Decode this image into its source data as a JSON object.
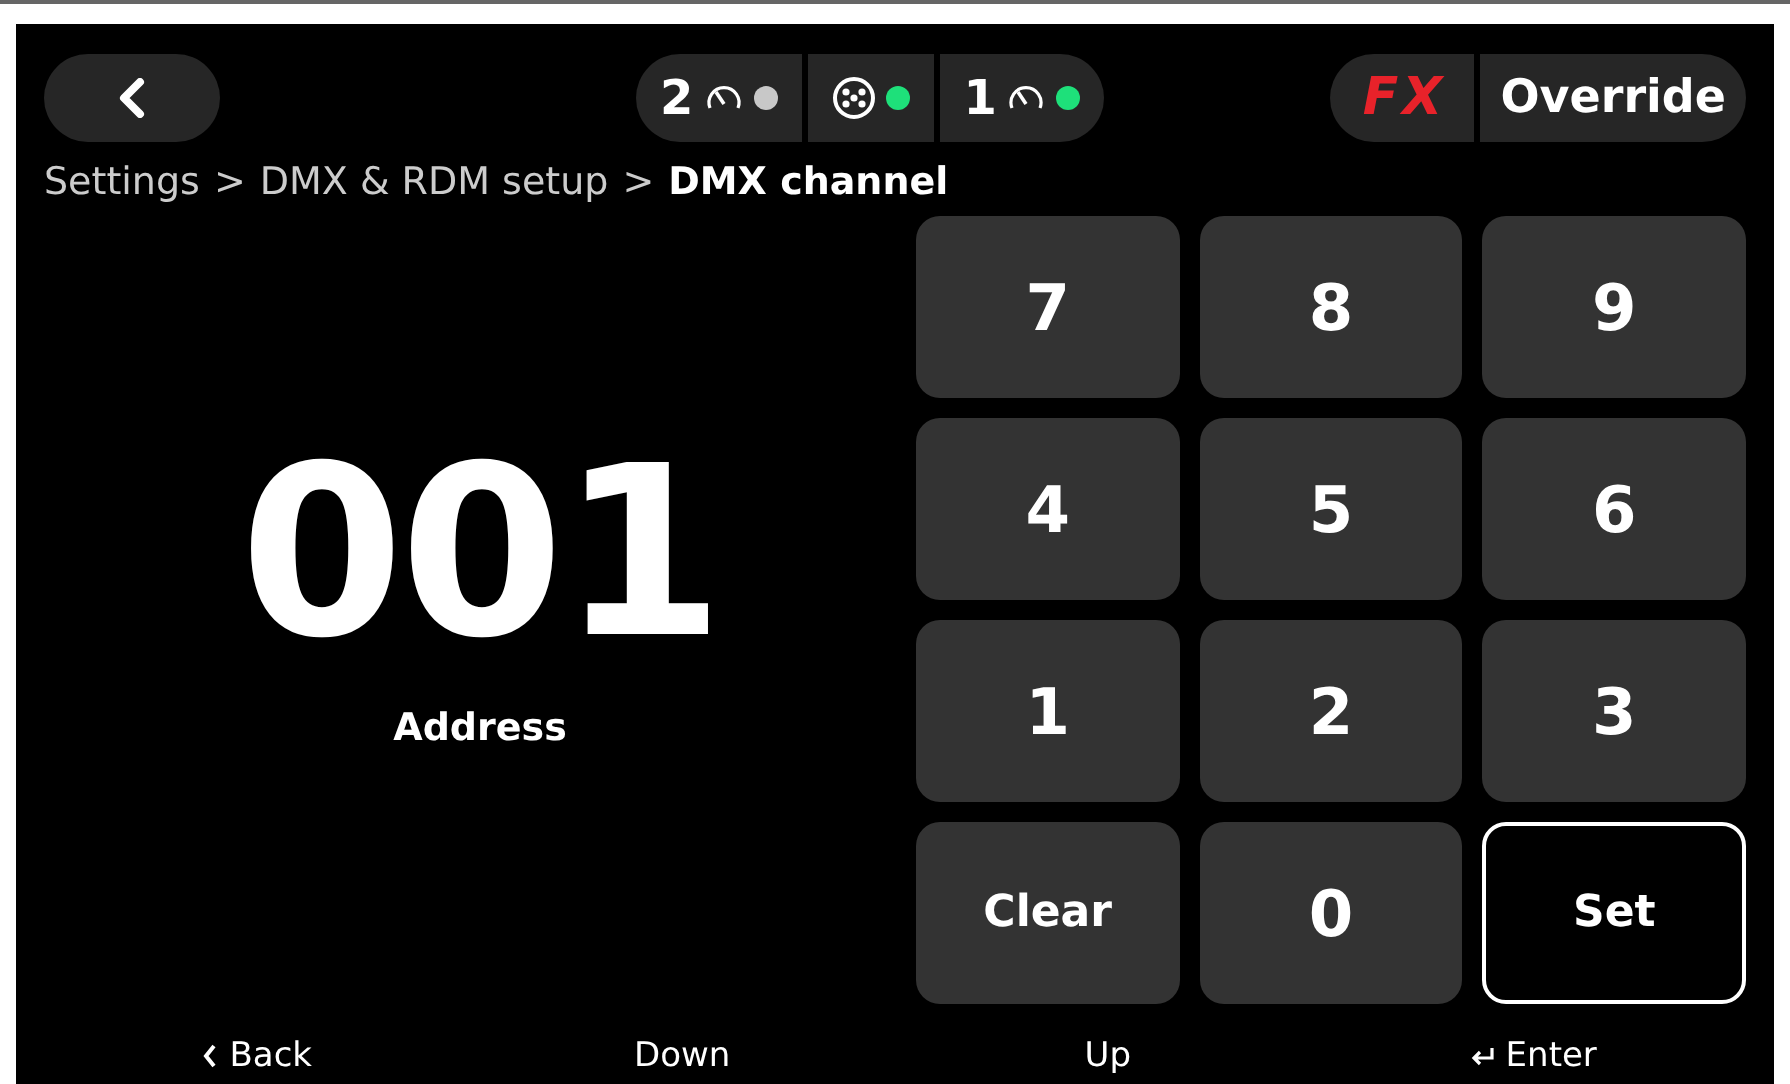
{
  "top_bar": {
    "status": [
      {
        "kind": "gauge",
        "label": "2",
        "color": "#c8c8c8"
      },
      {
        "kind": "dmx",
        "color": "#1ee07a"
      },
      {
        "kind": "gauge",
        "label": "1",
        "color": "#1ee07a"
      }
    ],
    "fx": "FX",
    "override": "Override"
  },
  "breadcrumb": [
    "Settings",
    "DMX & RDM setup",
    "DMX channel"
  ],
  "separator": ">",
  "display": {
    "value": "001",
    "label": "Address"
  },
  "keypad": [
    {
      "label": "7",
      "focused": false
    },
    {
      "label": "8",
      "focused": false
    },
    {
      "label": "9",
      "focused": false
    },
    {
      "label": "4",
      "focused": false
    },
    {
      "label": "5",
      "focused": false
    },
    {
      "label": "6",
      "focused": false
    },
    {
      "label": "1",
      "focused": false
    },
    {
      "label": "2",
      "focused": false
    },
    {
      "label": "3",
      "focused": false
    },
    {
      "label": "Clear",
      "focused": false
    },
    {
      "label": "0",
      "focused": false
    },
    {
      "label": "Set",
      "focused": true
    }
  ],
  "footer": [
    {
      "kind": "back",
      "label": "Back"
    },
    {
      "kind": "plain",
      "label": "Down"
    },
    {
      "kind": "plain",
      "label": "Up"
    },
    {
      "kind": "enter",
      "label": "Enter"
    }
  ]
}
